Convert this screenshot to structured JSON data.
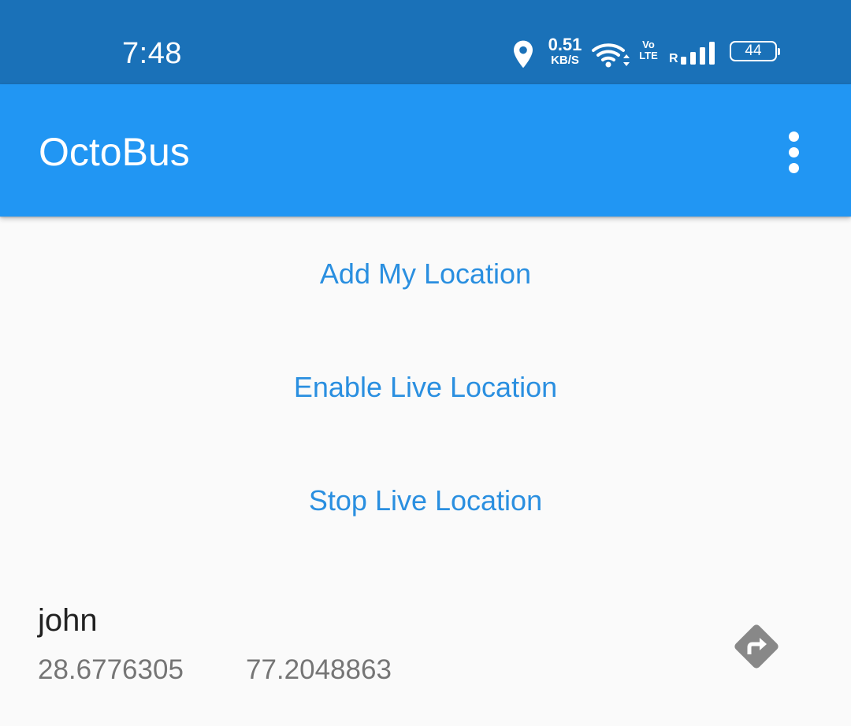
{
  "status_bar": {
    "time": "7:48",
    "net_speed_value": "0.51",
    "net_speed_unit": "KB/S",
    "volte_top": "Vo",
    "volte_bottom": "LTE",
    "roaming": "R",
    "battery_level": "44",
    "background_color": "#1a71b8",
    "icons": [
      "location-pin-icon",
      "wifi-icon",
      "volte-icon",
      "signal-strength-icon",
      "battery-icon"
    ]
  },
  "app_bar": {
    "title": "OctoBus",
    "color": "#2196f3",
    "menu_icon": "more-vert-icon"
  },
  "actions": {
    "add_location": "Add My Location",
    "enable_live": "Enable Live Location",
    "stop_live": "Stop Live Location",
    "text_color": "#2a8fe0"
  },
  "locations": [
    {
      "name": "john",
      "latitude": "28.6776305",
      "longitude": "77.2048863",
      "action_icon": "directions-icon"
    }
  ]
}
